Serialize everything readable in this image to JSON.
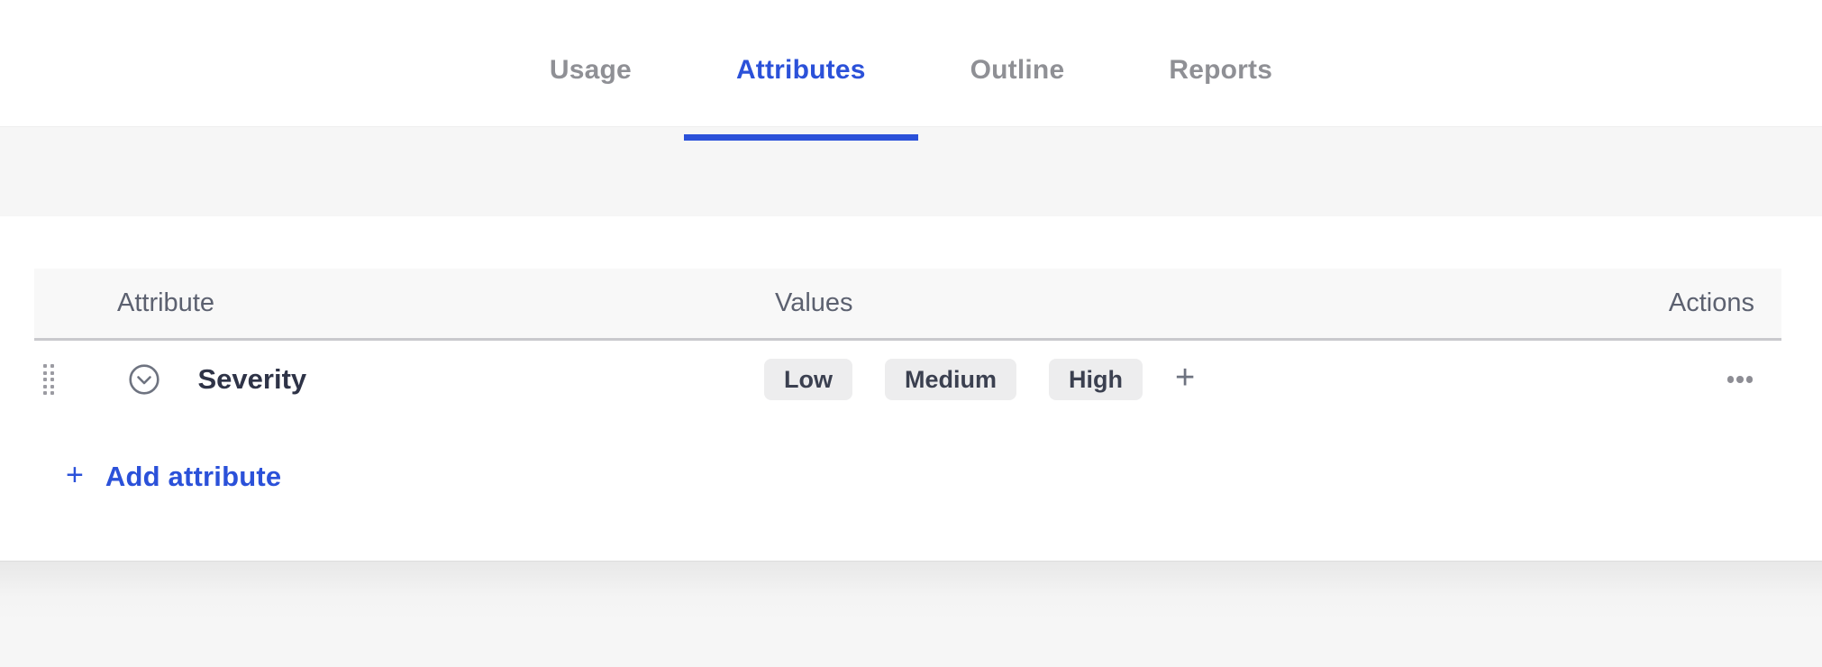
{
  "colors": {
    "accent": "#2b51d9",
    "tab_inactive": "#8f9095",
    "table_header_text": "#5c6170",
    "row_text": "#2e3347",
    "chip_background": "#ededee",
    "icon_gray": "#6e7380"
  },
  "tabs": [
    {
      "label": "Usage",
      "active": false
    },
    {
      "label": "Attributes",
      "active": true
    },
    {
      "label": "Outline",
      "active": false
    },
    {
      "label": "Reports",
      "active": false
    }
  ],
  "attributes_panel": {
    "columns": {
      "attribute": "Attribute",
      "values": "Values",
      "actions": "Actions"
    },
    "rows": [
      {
        "attribute": "Severity",
        "values": [
          "Low",
          "Medium",
          "High"
        ]
      }
    ],
    "add_value_icon_label": "+",
    "add_attribute": {
      "icon_label": "+",
      "label": "Add attribute"
    }
  },
  "icons": {
    "drag_handle": "drag-handle-dots",
    "collapse": "chevron-down-circle",
    "more_actions": "horizontal-ellipsis"
  }
}
